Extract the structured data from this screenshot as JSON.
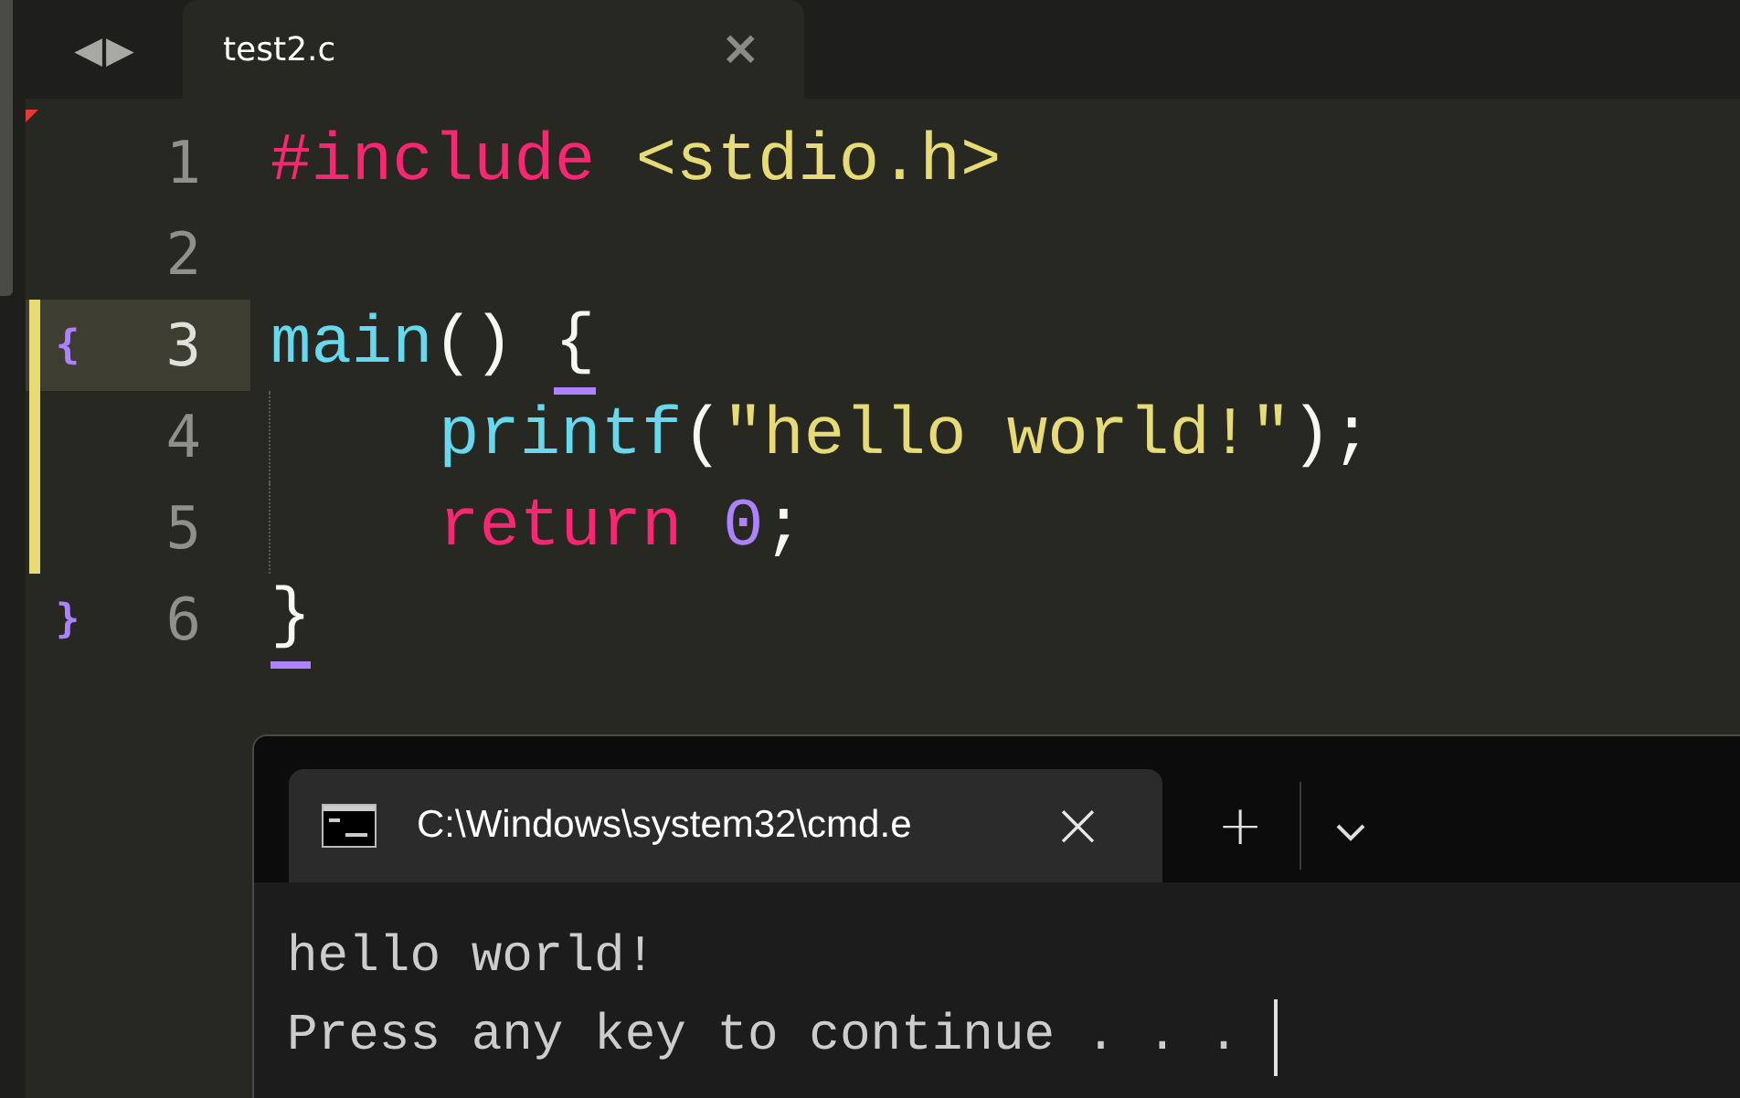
{
  "editor": {
    "nav": [
      "◀",
      "▶"
    ],
    "tab": {
      "title": "test2.c",
      "close": "×"
    },
    "lines": [
      {
        "number": "1",
        "current": false,
        "modified": false,
        "indented": false,
        "tokens": [
          {
            "kind": "keyword",
            "text": "#include"
          },
          {
            "kind": "string",
            "text": " <stdio.h>"
          }
        ]
      },
      {
        "number": "2",
        "current": false,
        "modified": false,
        "indented": false
      },
      {
        "number": "3",
        "current": true,
        "modified": true,
        "indented": false,
        "marker": "{",
        "tokens": [
          {
            "kind": "function",
            "text": "main"
          },
          {
            "kind": "plain",
            "text": "() "
          },
          {
            "kind": "plain",
            "text": "{",
            "matched": true
          }
        ]
      },
      {
        "number": "4",
        "current": false,
        "modified": true,
        "indented": true,
        "tokens": [
          {
            "kind": "function",
            "text": "printf"
          },
          {
            "kind": "plain",
            "text": "("
          },
          {
            "kind": "string",
            "text": "\"hello world!\""
          },
          {
            "kind": "plain",
            "text": ");"
          }
        ]
      },
      {
        "number": "5",
        "current": false,
        "modified": true,
        "indented": true,
        "tokens": [
          {
            "kind": "keyword",
            "text": "return"
          },
          {
            "kind": "number",
            "text": " 0"
          },
          {
            "kind": "plain",
            "text": ";"
          }
        ]
      },
      {
        "number": "6",
        "current": false,
        "modified": false,
        "indented": false,
        "marker": "}",
        "tokens": [
          {
            "kind": "plain",
            "text": "}",
            "matched": true
          }
        ]
      }
    ]
  },
  "terminal": {
    "tab": {
      "title": "C:\\Windows\\system32\\cmd.e",
      "close": "×"
    },
    "new_tab": "+",
    "output": [
      "hello world!",
      "Press any key to continue . . ."
    ]
  }
}
